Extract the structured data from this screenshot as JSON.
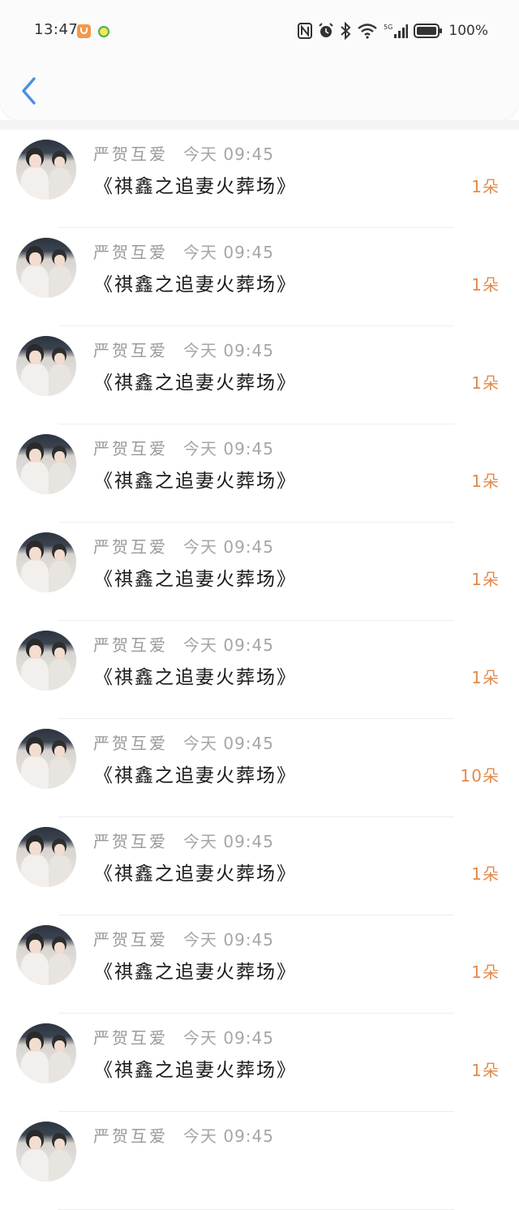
{
  "status_bar": {
    "time": "13:47",
    "battery": "100%",
    "network": "5G",
    "icons": [
      "nfc-icon",
      "alarm-icon",
      "bluetooth-icon",
      "wifi-icon",
      "signal-icon",
      "battery-icon"
    ]
  },
  "header": {
    "back_icon": "chevron-left-icon",
    "accent": "#4a90e2"
  },
  "colors": {
    "count": "#e28a4c",
    "name": "#9a9a9a",
    "title": "#1a1a1a"
  },
  "gifts": [
    {
      "user": "严贺互爱",
      "time": "今天 09:45",
      "title": "《祺鑫之追妻火葬场》",
      "count": "1朵"
    },
    {
      "user": "严贺互爱",
      "time": "今天 09:45",
      "title": "《祺鑫之追妻火葬场》",
      "count": "1朵"
    },
    {
      "user": "严贺互爱",
      "time": "今天 09:45",
      "title": "《祺鑫之追妻火葬场》",
      "count": "1朵"
    },
    {
      "user": "严贺互爱",
      "time": "今天 09:45",
      "title": "《祺鑫之追妻火葬场》",
      "count": "1朵"
    },
    {
      "user": "严贺互爱",
      "time": "今天 09:45",
      "title": "《祺鑫之追妻火葬场》",
      "count": "1朵"
    },
    {
      "user": "严贺互爱",
      "time": "今天 09:45",
      "title": "《祺鑫之追妻火葬场》",
      "count": "1朵"
    },
    {
      "user": "严贺互爱",
      "time": "今天 09:45",
      "title": "《祺鑫之追妻火葬场》",
      "count": "10朵"
    },
    {
      "user": "严贺互爱",
      "time": "今天 09:45",
      "title": "《祺鑫之追妻火葬场》",
      "count": "1朵"
    },
    {
      "user": "严贺互爱",
      "time": "今天 09:45",
      "title": "《祺鑫之追妻火葬场》",
      "count": "1朵"
    },
    {
      "user": "严贺互爱",
      "time": "今天 09:45",
      "title": "《祺鑫之追妻火葬场》",
      "count": "1朵"
    },
    {
      "user": "严贺互爱",
      "time": "今天 09:45",
      "title": "",
      "count": ""
    }
  ]
}
